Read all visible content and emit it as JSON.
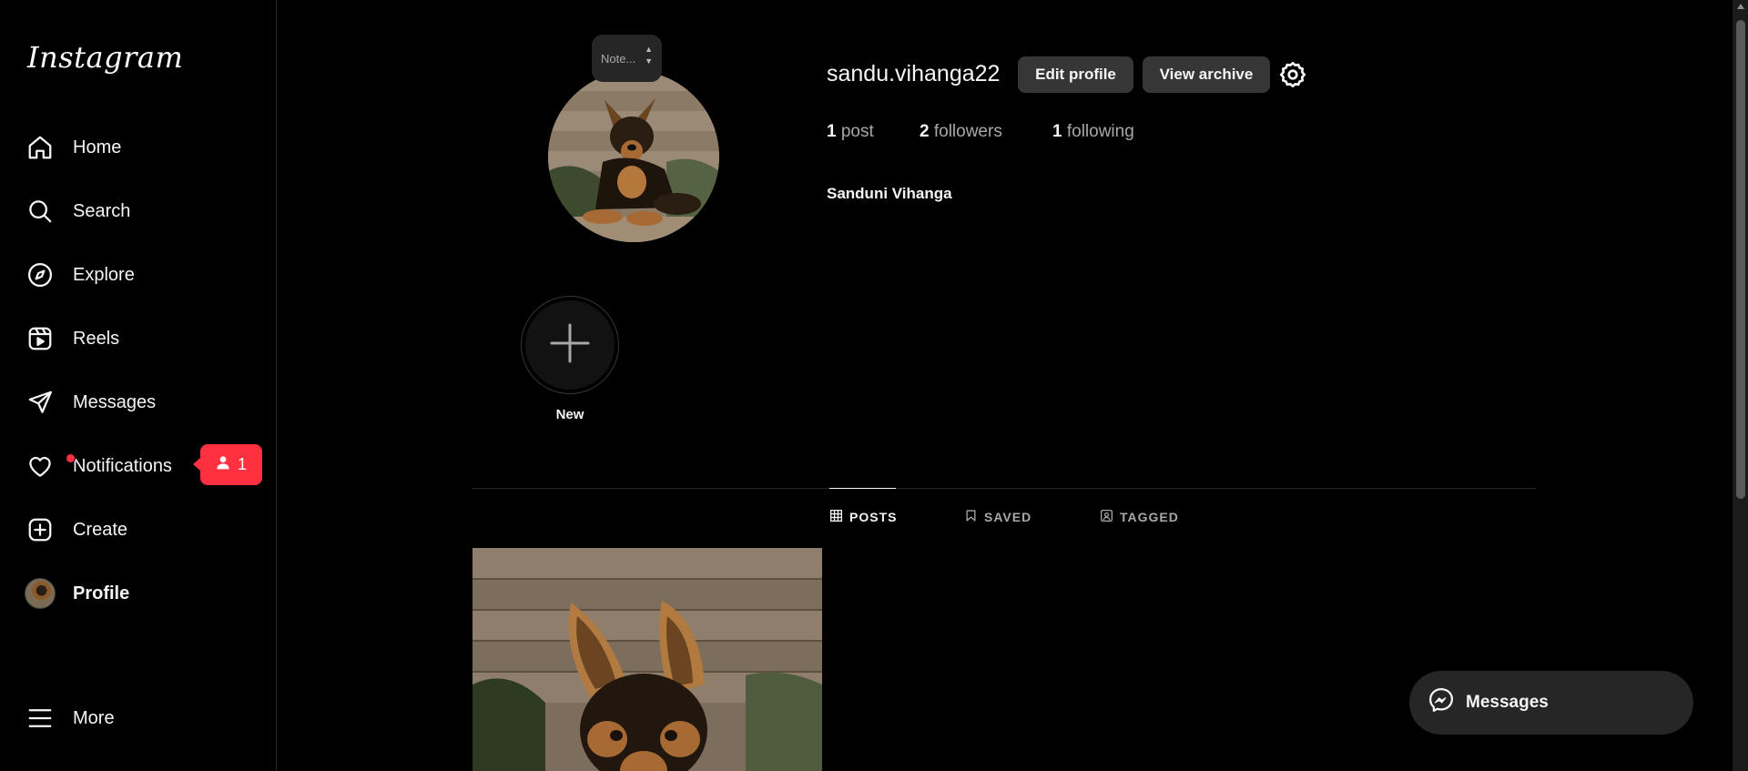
{
  "app": {
    "logo_text": "Instagram"
  },
  "sidebar": {
    "items": [
      {
        "label": "Home",
        "icon": "home-icon"
      },
      {
        "label": "Search",
        "icon": "search-icon"
      },
      {
        "label": "Explore",
        "icon": "compass-icon"
      },
      {
        "label": "Reels",
        "icon": "reels-icon"
      },
      {
        "label": "Messages",
        "icon": "paper-plane-icon"
      },
      {
        "label": "Notifications",
        "icon": "heart-icon"
      },
      {
        "label": "Create",
        "icon": "plus-square-icon"
      },
      {
        "label": "Profile",
        "icon": "avatar"
      },
      {
        "label": "More",
        "icon": "hamburger-icon"
      }
    ],
    "notification_popup": {
      "count": "1",
      "icon": "person-icon"
    }
  },
  "profile": {
    "note_placeholder": "Note...",
    "username": "sandu.vihanga22",
    "edit_button": "Edit profile",
    "archive_button": "View archive",
    "stats": {
      "posts_count": "1",
      "posts_label": "post",
      "followers_count": "2",
      "followers_label": "followers",
      "following_count": "1",
      "following_label": "following"
    },
    "full_name": "Sanduni Vihanga",
    "highlight_new_label": "New"
  },
  "tabs": [
    {
      "label": "POSTS",
      "active": true
    },
    {
      "label": "SAVED",
      "active": false
    },
    {
      "label": "TAGGED",
      "active": false
    }
  ],
  "messages_float": {
    "label": "Messages"
  },
  "colors": {
    "background": "#000000",
    "badge": "#ff3040",
    "button": "#363636"
  }
}
